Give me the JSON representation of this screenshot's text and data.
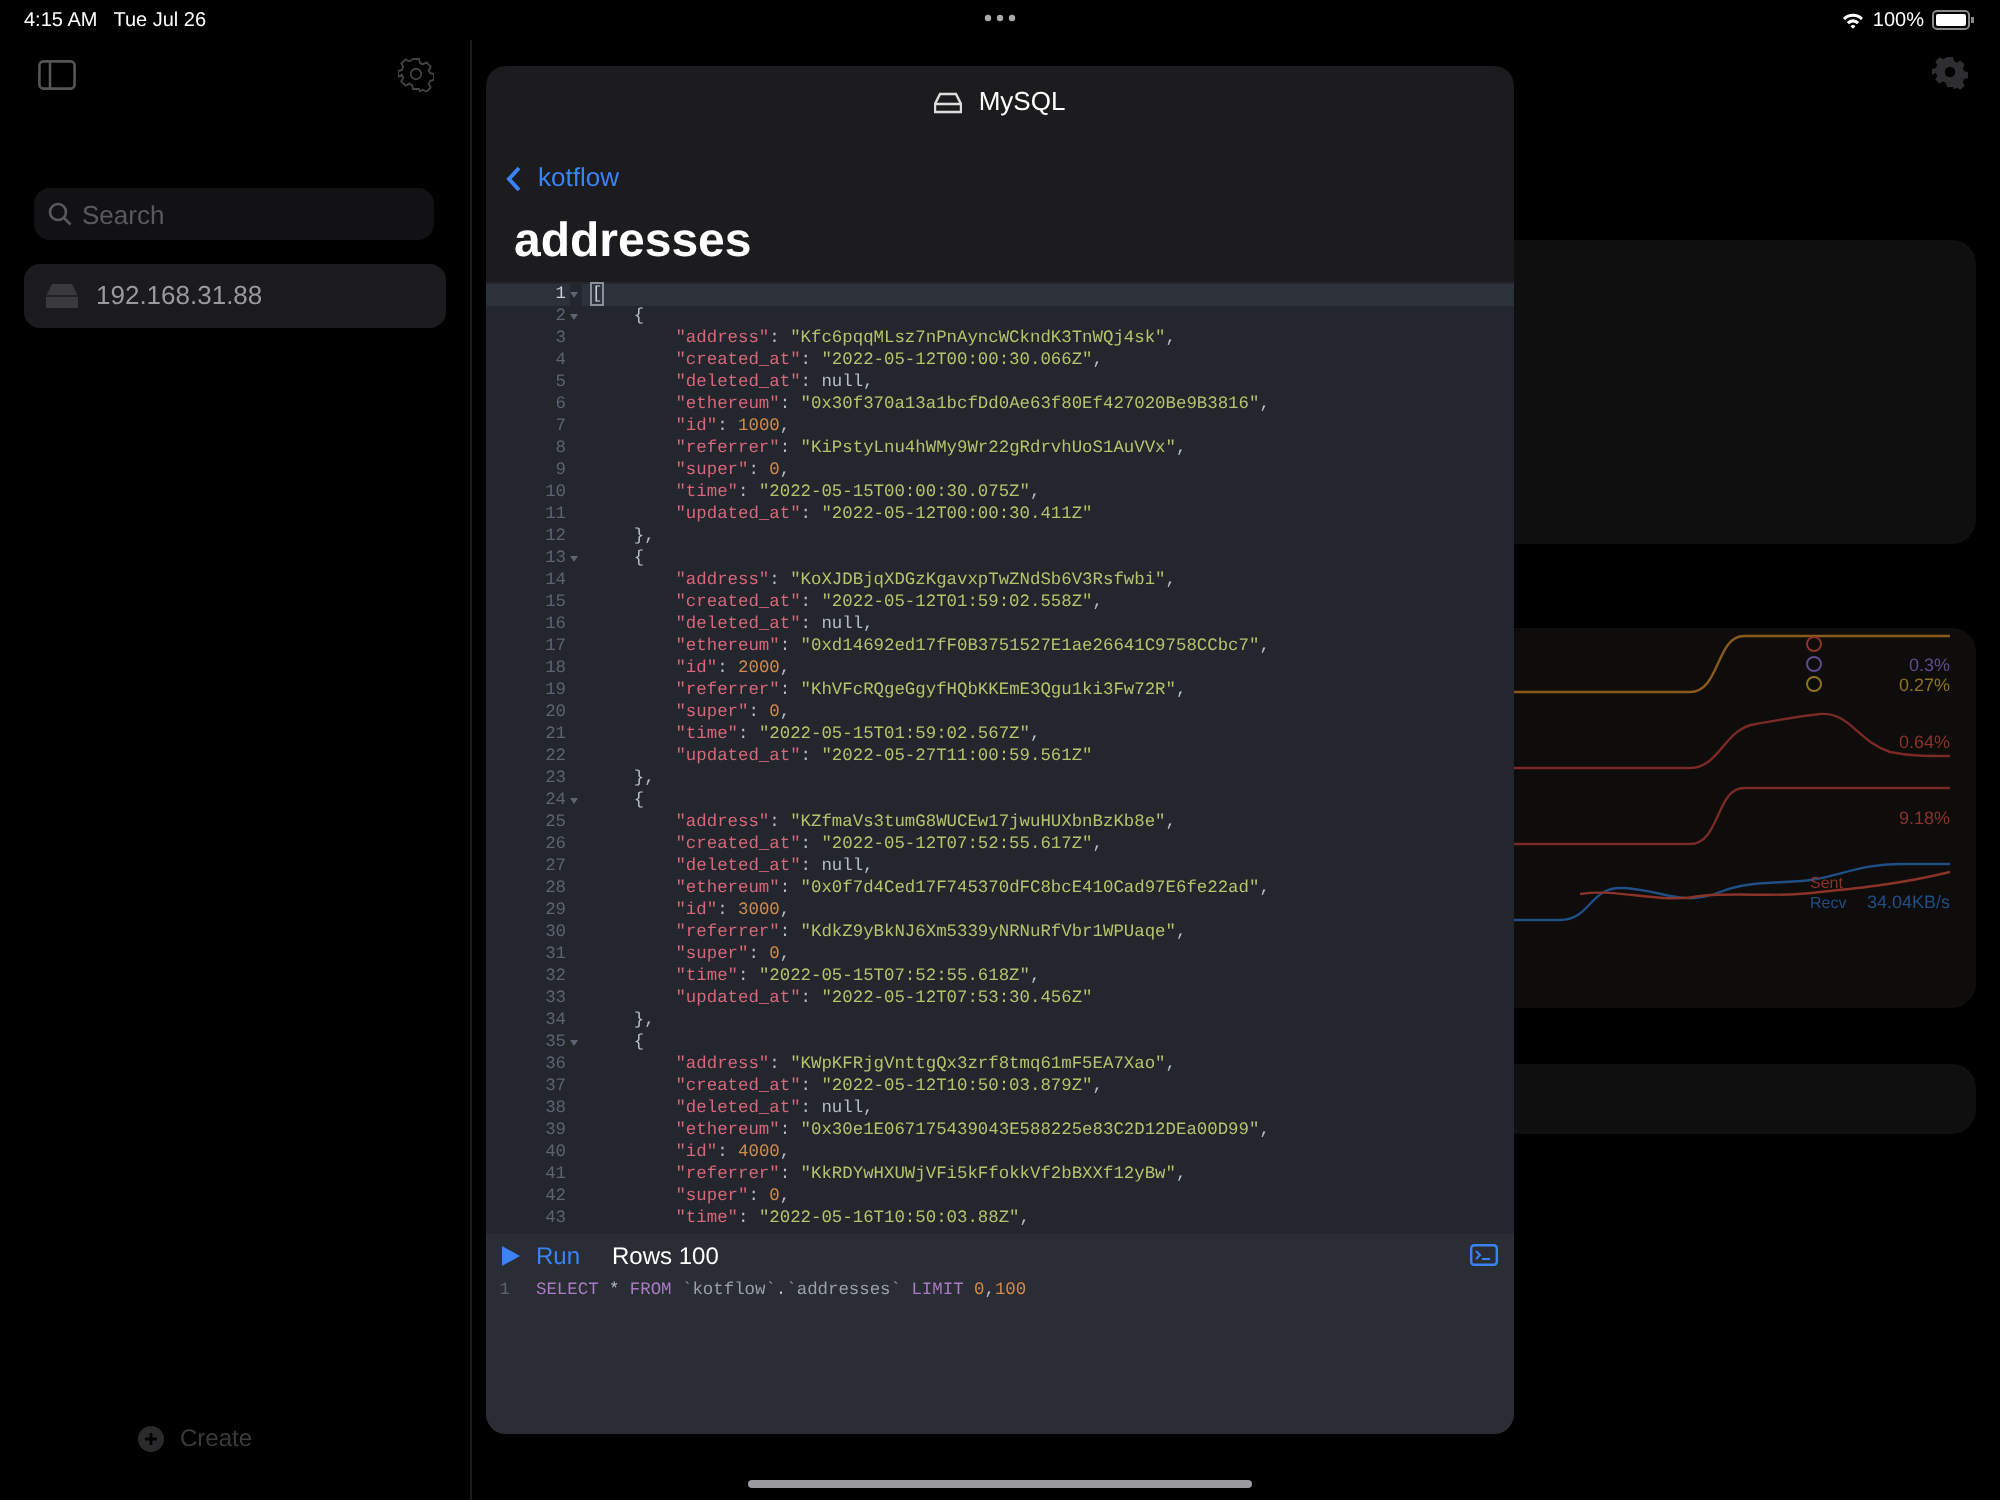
{
  "status_bar": {
    "time": "4:15 AM",
    "date": "Tue Jul 26",
    "battery": "100%"
  },
  "sidebar": {
    "search": {
      "placeholder": "Search"
    },
    "servers": [
      {
        "label": "192.168.31.88",
        "selected": true
      }
    ],
    "create": "Create"
  },
  "dashboard": {
    "legend": [
      {
        "color": "#8a3328"
      },
      {
        "color": "#5e4a8c",
        "value": "0.3%"
      },
      {
        "color": "#8a7322",
        "value": "0.27%"
      }
    ],
    "readings": [
      "0.64%",
      "9.18%"
    ],
    "network": [
      {
        "label": "Sent",
        "color": "#8a3328"
      },
      {
        "label": "Recv",
        "color": "#1f4f86",
        "value": "34.04KB/s"
      }
    ]
  },
  "sheet": {
    "title": "MySQL",
    "back": "kotflow",
    "heading": "addresses",
    "editor": {
      "lines": [
        {
          "n": "1",
          "text": "[",
          "fold": true,
          "active": true
        },
        {
          "n": "2",
          "text": "    {",
          "fold": true,
          "active": false
        },
        {
          "n": "3",
          "text": "        \"address\": \"Kfc6pqqMLsz7nPnAyncWCkndK3TnWQj4sk\",",
          "fold": false,
          "active": false
        },
        {
          "n": "4",
          "text": "        \"created_at\": \"2022-05-12T00:00:30.066Z\",",
          "fold": false,
          "active": false
        },
        {
          "n": "5",
          "text": "        \"deleted_at\": null,",
          "fold": false,
          "active": false
        },
        {
          "n": "6",
          "text": "        \"ethereum\": \"0x30f370a13a1bcfDd0Ae63f80Ef427020Be9B3816\",",
          "fold": false,
          "active": false
        },
        {
          "n": "7",
          "text": "        \"id\": 1000,",
          "fold": false,
          "active": false
        },
        {
          "n": "8",
          "text": "        \"referrer\": \"KiPstyLnu4hWMy9Wr22gRdrvhUoS1AuVVx\",",
          "fold": false,
          "active": false
        },
        {
          "n": "9",
          "text": "        \"super\": 0,",
          "fold": false,
          "active": false
        },
        {
          "n": "10",
          "text": "        \"time\": \"2022-05-15T00:00:30.075Z\",",
          "fold": false,
          "active": false
        },
        {
          "n": "11",
          "text": "        \"updated_at\": \"2022-05-12T00:00:30.411Z\"",
          "fold": false,
          "active": false
        },
        {
          "n": "12",
          "text": "    },",
          "fold": false,
          "active": false
        },
        {
          "n": "13",
          "text": "    {",
          "fold": true,
          "active": false
        },
        {
          "n": "14",
          "text": "        \"address\": \"KoXJDBjqXDGzKgavxpTwZNdSb6V3Rsfwbi\",",
          "fold": false,
          "active": false
        },
        {
          "n": "15",
          "text": "        \"created_at\": \"2022-05-12T01:59:02.558Z\",",
          "fold": false,
          "active": false
        },
        {
          "n": "16",
          "text": "        \"deleted_at\": null,",
          "fold": false,
          "active": false
        },
        {
          "n": "17",
          "text": "        \"ethereum\": \"0xd14692ed17fF0B3751527E1ae26641C9758CCbc7\",",
          "fold": false,
          "active": false
        },
        {
          "n": "18",
          "text": "        \"id\": 2000,",
          "fold": false,
          "active": false
        },
        {
          "n": "19",
          "text": "        \"referrer\": \"KhVFcRQgeGgyfHQbKKEmE3Qgu1ki3Fw72R\",",
          "fold": false,
          "active": false
        },
        {
          "n": "20",
          "text": "        \"super\": 0,",
          "fold": false,
          "active": false
        },
        {
          "n": "21",
          "text": "        \"time\": \"2022-05-15T01:59:02.567Z\",",
          "fold": false,
          "active": false
        },
        {
          "n": "22",
          "text": "        \"updated_at\": \"2022-05-27T11:00:59.561Z\"",
          "fold": false,
          "active": false
        },
        {
          "n": "23",
          "text": "    },",
          "fold": false,
          "active": false
        },
        {
          "n": "24",
          "text": "    {",
          "fold": true,
          "active": false
        },
        {
          "n": "25",
          "text": "        \"address\": \"KZfmaVs3tumG8WUCEw17jwuHUXbnBzKb8e\",",
          "fold": false,
          "active": false
        },
        {
          "n": "26",
          "text": "        \"created_at\": \"2022-05-12T07:52:55.617Z\",",
          "fold": false,
          "active": false
        },
        {
          "n": "27",
          "text": "        \"deleted_at\": null,",
          "fold": false,
          "active": false
        },
        {
          "n": "28",
          "text": "        \"ethereum\": \"0x0f7d4Ced17F745370dFC8bcE410Cad97E6fe22ad\",",
          "fold": false,
          "active": false
        },
        {
          "n": "29",
          "text": "        \"id\": 3000,",
          "fold": false,
          "active": false
        },
        {
          "n": "30",
          "text": "        \"referrer\": \"KdkZ9yBkNJ6Xm5339yNRNuRfVbr1WPUaqe\",",
          "fold": false,
          "active": false
        },
        {
          "n": "31",
          "text": "        \"super\": 0,",
          "fold": false,
          "active": false
        },
        {
          "n": "32",
          "text": "        \"time\": \"2022-05-15T07:52:55.618Z\",",
          "fold": false,
          "active": false
        },
        {
          "n": "33",
          "text": "        \"updated_at\": \"2022-05-12T07:53:30.456Z\"",
          "fold": false,
          "active": false
        },
        {
          "n": "34",
          "text": "    },",
          "fold": false,
          "active": false
        },
        {
          "n": "35",
          "text": "    {",
          "fold": true,
          "active": false
        },
        {
          "n": "36",
          "text": "        \"address\": \"KWpKFRjgVnttgQx3zrf8tmq61mF5EA7Xao\",",
          "fold": false,
          "active": false
        },
        {
          "n": "37",
          "text": "        \"created_at\": \"2022-05-12T10:50:03.879Z\",",
          "fold": false,
          "active": false
        },
        {
          "n": "38",
          "text": "        \"deleted_at\": null,",
          "fold": false,
          "active": false
        },
        {
          "n": "39",
          "text": "        \"ethereum\": \"0x30e1E067175439043E588225e83C2D12DEa00D99\",",
          "fold": false,
          "active": false
        },
        {
          "n": "40",
          "text": "        \"id\": 4000,",
          "fold": false,
          "active": false
        },
        {
          "n": "41",
          "text": "        \"referrer\": \"KkRDYwHXUWjVFi5kFfokkVf2bBXXf12yBw\",",
          "fold": false,
          "active": false
        },
        {
          "n": "42",
          "text": "        \"super\": 0,",
          "fold": false,
          "active": false
        },
        {
          "n": "43",
          "text": "        \"time\": \"2022-05-16T10:50:03.88Z\",",
          "fold": false,
          "active": false
        }
      ]
    },
    "toolbar": {
      "run": "Run",
      "rows": "Rows 100"
    },
    "query": {
      "n": "1",
      "text": "SELECT * FROM `kotflow`.`addresses` LIMIT 0,100"
    }
  }
}
